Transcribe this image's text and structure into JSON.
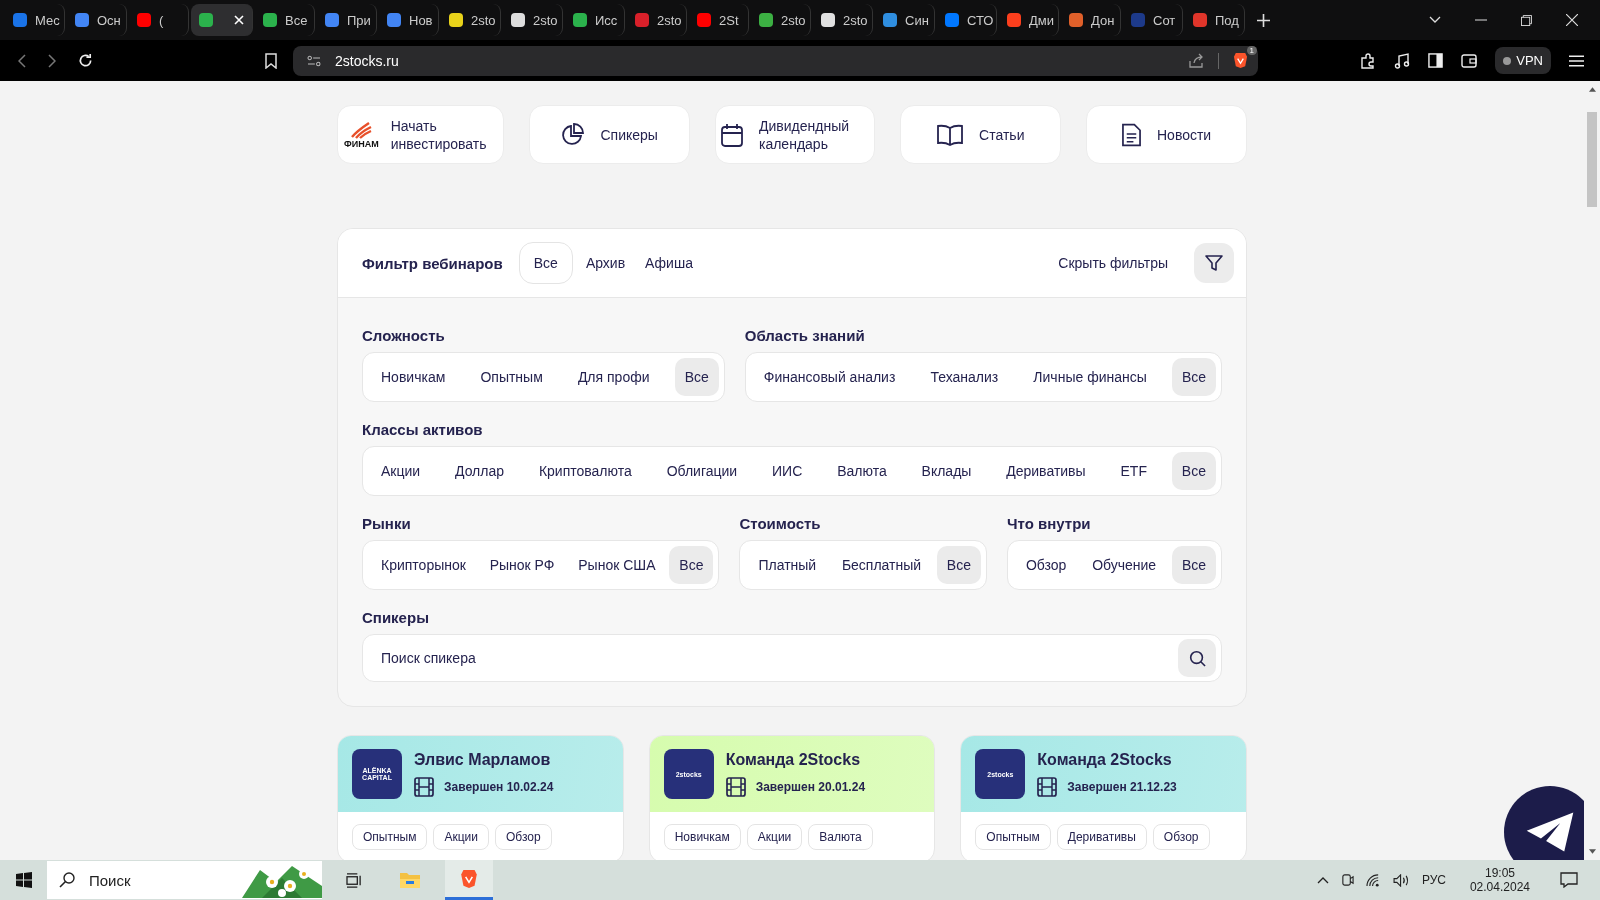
{
  "browser": {
    "tabs": [
      {
        "title": "Мес",
        "selected": false,
        "color": "#1a73e8"
      },
      {
        "title": "Осн",
        "selected": false,
        "color": "#4285f4"
      },
      {
        "title": "(",
        "selected": false,
        "color": "#ff0000"
      },
      {
        "selected": true,
        "color": "#2bb24c"
      },
      {
        "title": "Все",
        "selected": false,
        "color": "#2bb24c"
      },
      {
        "title": "При",
        "selected": false,
        "color": "#4285f4"
      },
      {
        "title": "Нов",
        "selected": false,
        "color": "#4285f4"
      },
      {
        "title": "2sto",
        "selected": false,
        "color": "#e8d21a"
      },
      {
        "title": "2sto",
        "selected": false,
        "color": "#dddddd"
      },
      {
        "title": "Исс",
        "selected": false,
        "color": "#2bb24c"
      },
      {
        "title": "2sto",
        "selected": false,
        "color": "#d8202a"
      },
      {
        "title": "2St",
        "selected": false,
        "color": "#ff0000"
      },
      {
        "title": "2sto",
        "selected": false,
        "color": "#3cb043"
      },
      {
        "title": "2sto",
        "selected": false,
        "color": "#e0e0e0"
      },
      {
        "title": "Син",
        "selected": false,
        "color": "#2f8ee0"
      },
      {
        "title": "СТО",
        "selected": false,
        "color": "#0077ff"
      },
      {
        "title": "Дми",
        "selected": false,
        "color": "#fc3f1d"
      },
      {
        "title": "Дон",
        "selected": false,
        "color": "#e0602a"
      },
      {
        "title": "Сот",
        "selected": false,
        "color": "#1d3a8a"
      },
      {
        "title": "Под",
        "selected": false,
        "color": "#e0352a"
      }
    ],
    "address": "2stocks.ru",
    "shields_count": "1",
    "vpn": "VPN"
  },
  "nav": [
    {
      "kind": "finam",
      "label": "Начать инвестировать",
      "logo_text": "ФИНАМ"
    },
    {
      "kind": "pie",
      "label": "Спикеры"
    },
    {
      "kind": "calendar",
      "label": "Дивидендный календарь"
    },
    {
      "kind": "book",
      "label": "Статьи"
    },
    {
      "kind": "doc",
      "label": "Новости"
    }
  ],
  "filter": {
    "title": "Фильтр вебинаров",
    "tabs": [
      {
        "label": "Все",
        "selected": true
      },
      {
        "label": "Архив",
        "selected": false
      },
      {
        "label": "Афиша",
        "selected": false
      }
    ],
    "hide_label": "Скрыть фильтры",
    "rows": [
      [
        {
          "title": "Сложность",
          "options": [
            {
              "label": "Новичкам",
              "selected": false
            },
            {
              "label": "Опытным",
              "selected": false
            },
            {
              "label": "Для профи",
              "selected": false
            },
            {
              "label": "Все",
              "selected": true
            }
          ]
        },
        {
          "title": "Область знаний",
          "options": [
            {
              "label": "Финансовый анализ",
              "selected": false
            },
            {
              "label": "Теханализ",
              "selected": false
            },
            {
              "label": "Личные финансы",
              "selected": false
            },
            {
              "label": "Все",
              "selected": true
            }
          ]
        }
      ],
      [
        {
          "title": "Классы активов",
          "options": [
            {
              "label": "Акции",
              "selected": false
            },
            {
              "label": "Доллар",
              "selected": false
            },
            {
              "label": "Криптовалюта",
              "selected": false
            },
            {
              "label": "Облигации",
              "selected": false
            },
            {
              "label": "ИИС",
              "selected": false
            },
            {
              "label": "Валюта",
              "selected": false
            },
            {
              "label": "Вклады",
              "selected": false
            },
            {
              "label": "Деривативы",
              "selected": false
            },
            {
              "label": "ETF",
              "selected": false
            },
            {
              "label": "Все",
              "selected": true
            }
          ]
        }
      ],
      [
        {
          "title": "Рынки",
          "options": [
            {
              "label": "Крипторынок",
              "selected": false
            },
            {
              "label": "Рынок РФ",
              "selected": false
            },
            {
              "label": "Рынок США",
              "selected": false
            },
            {
              "label": "Все",
              "selected": true
            }
          ]
        },
        {
          "title": "Стоимость",
          "options": [
            {
              "label": "Платный",
              "selected": false
            },
            {
              "label": "Бесплатный",
              "selected": false
            },
            {
              "label": "Все",
              "selected": true
            }
          ]
        },
        {
          "title": "Что внутри",
          "options": [
            {
              "label": "Обзор",
              "selected": false
            },
            {
              "label": "Обучение",
              "selected": false
            },
            {
              "label": "Все",
              "selected": true
            }
          ]
        }
      ]
    ],
    "speakers": {
      "title": "Спикеры",
      "placeholder": "Поиск спикера"
    }
  },
  "cards": [
    {
      "name": "Элвис Марламов",
      "logo_text": "ALЁNKA CAPITAL",
      "status": "Завершен 10.02.24",
      "color": "#a6e8e6",
      "tags": [
        "Опытным",
        "Акции",
        "Обзор"
      ]
    },
    {
      "name": "Команда 2Stocks",
      "logo_text": "2stocks",
      "status": "Завершен 20.01.24",
      "color": "#d6fcae",
      "tags": [
        "Новичкам",
        "Акции",
        "Валюта"
      ]
    },
    {
      "name": "Команда 2Stocks",
      "logo_text": "2stocks",
      "status": "Завершен 21.12.23",
      "color": "#a6e8e6",
      "tags": [
        "Опытным",
        "Деривативы",
        "Обзор"
      ]
    }
  ],
  "taskbar": {
    "search_placeholder": "Поиск",
    "language": "РУС",
    "time": "19:05",
    "date": "02.04.2024"
  }
}
